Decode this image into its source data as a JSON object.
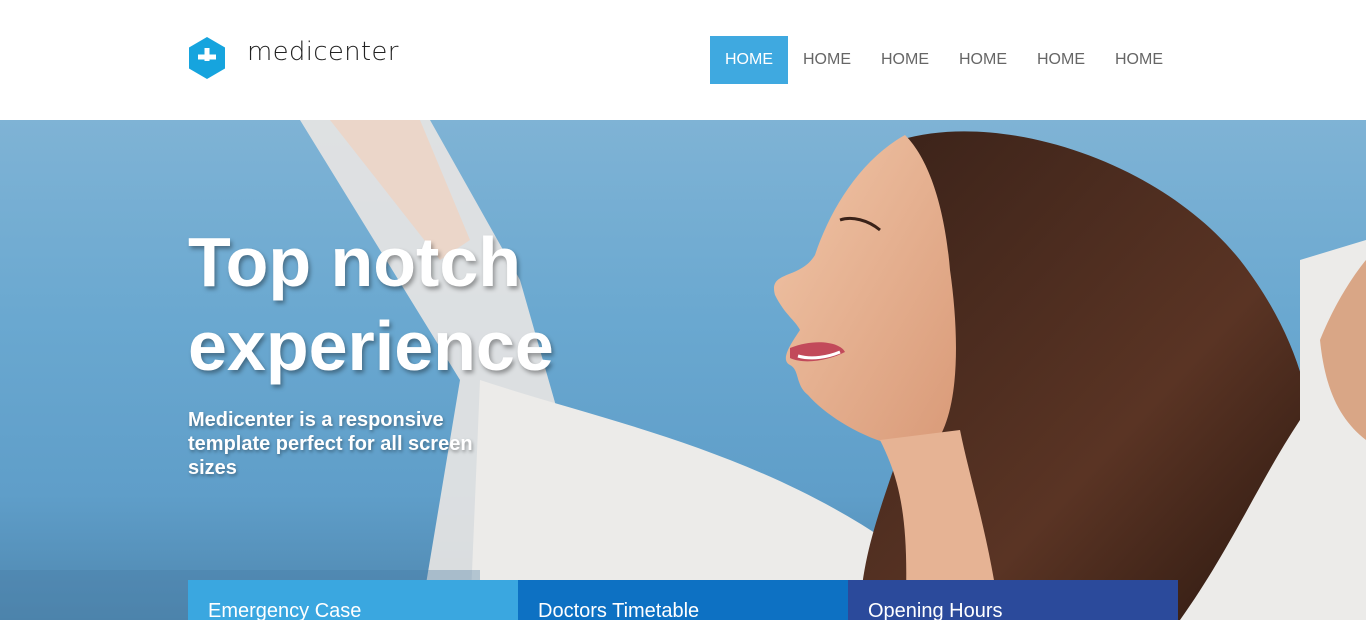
{
  "brand": {
    "name": "medicenter"
  },
  "nav": {
    "items": [
      {
        "label": "HOME",
        "active": true
      },
      {
        "label": "HOME",
        "active": false
      },
      {
        "label": "HOME",
        "active": false
      },
      {
        "label": "HOME",
        "active": false
      },
      {
        "label": "HOME",
        "active": false
      },
      {
        "label": "HOME",
        "active": false
      }
    ]
  },
  "hero": {
    "title": "Top notch experience",
    "subtitle": "Medicenter is a responsive template perfect for all screen sizes"
  },
  "info_boxes": [
    {
      "label": "Emergency Case"
    },
    {
      "label": "Doctors Timetable"
    },
    {
      "label": "Opening Hours"
    }
  ],
  "colors": {
    "accent": "#3fa9e0",
    "box_1": "#3aa7e0",
    "box_2": "#0d71c3",
    "box_3": "#2b4a9b"
  },
  "icons": {
    "logo": "plus-hexagon-icon"
  }
}
